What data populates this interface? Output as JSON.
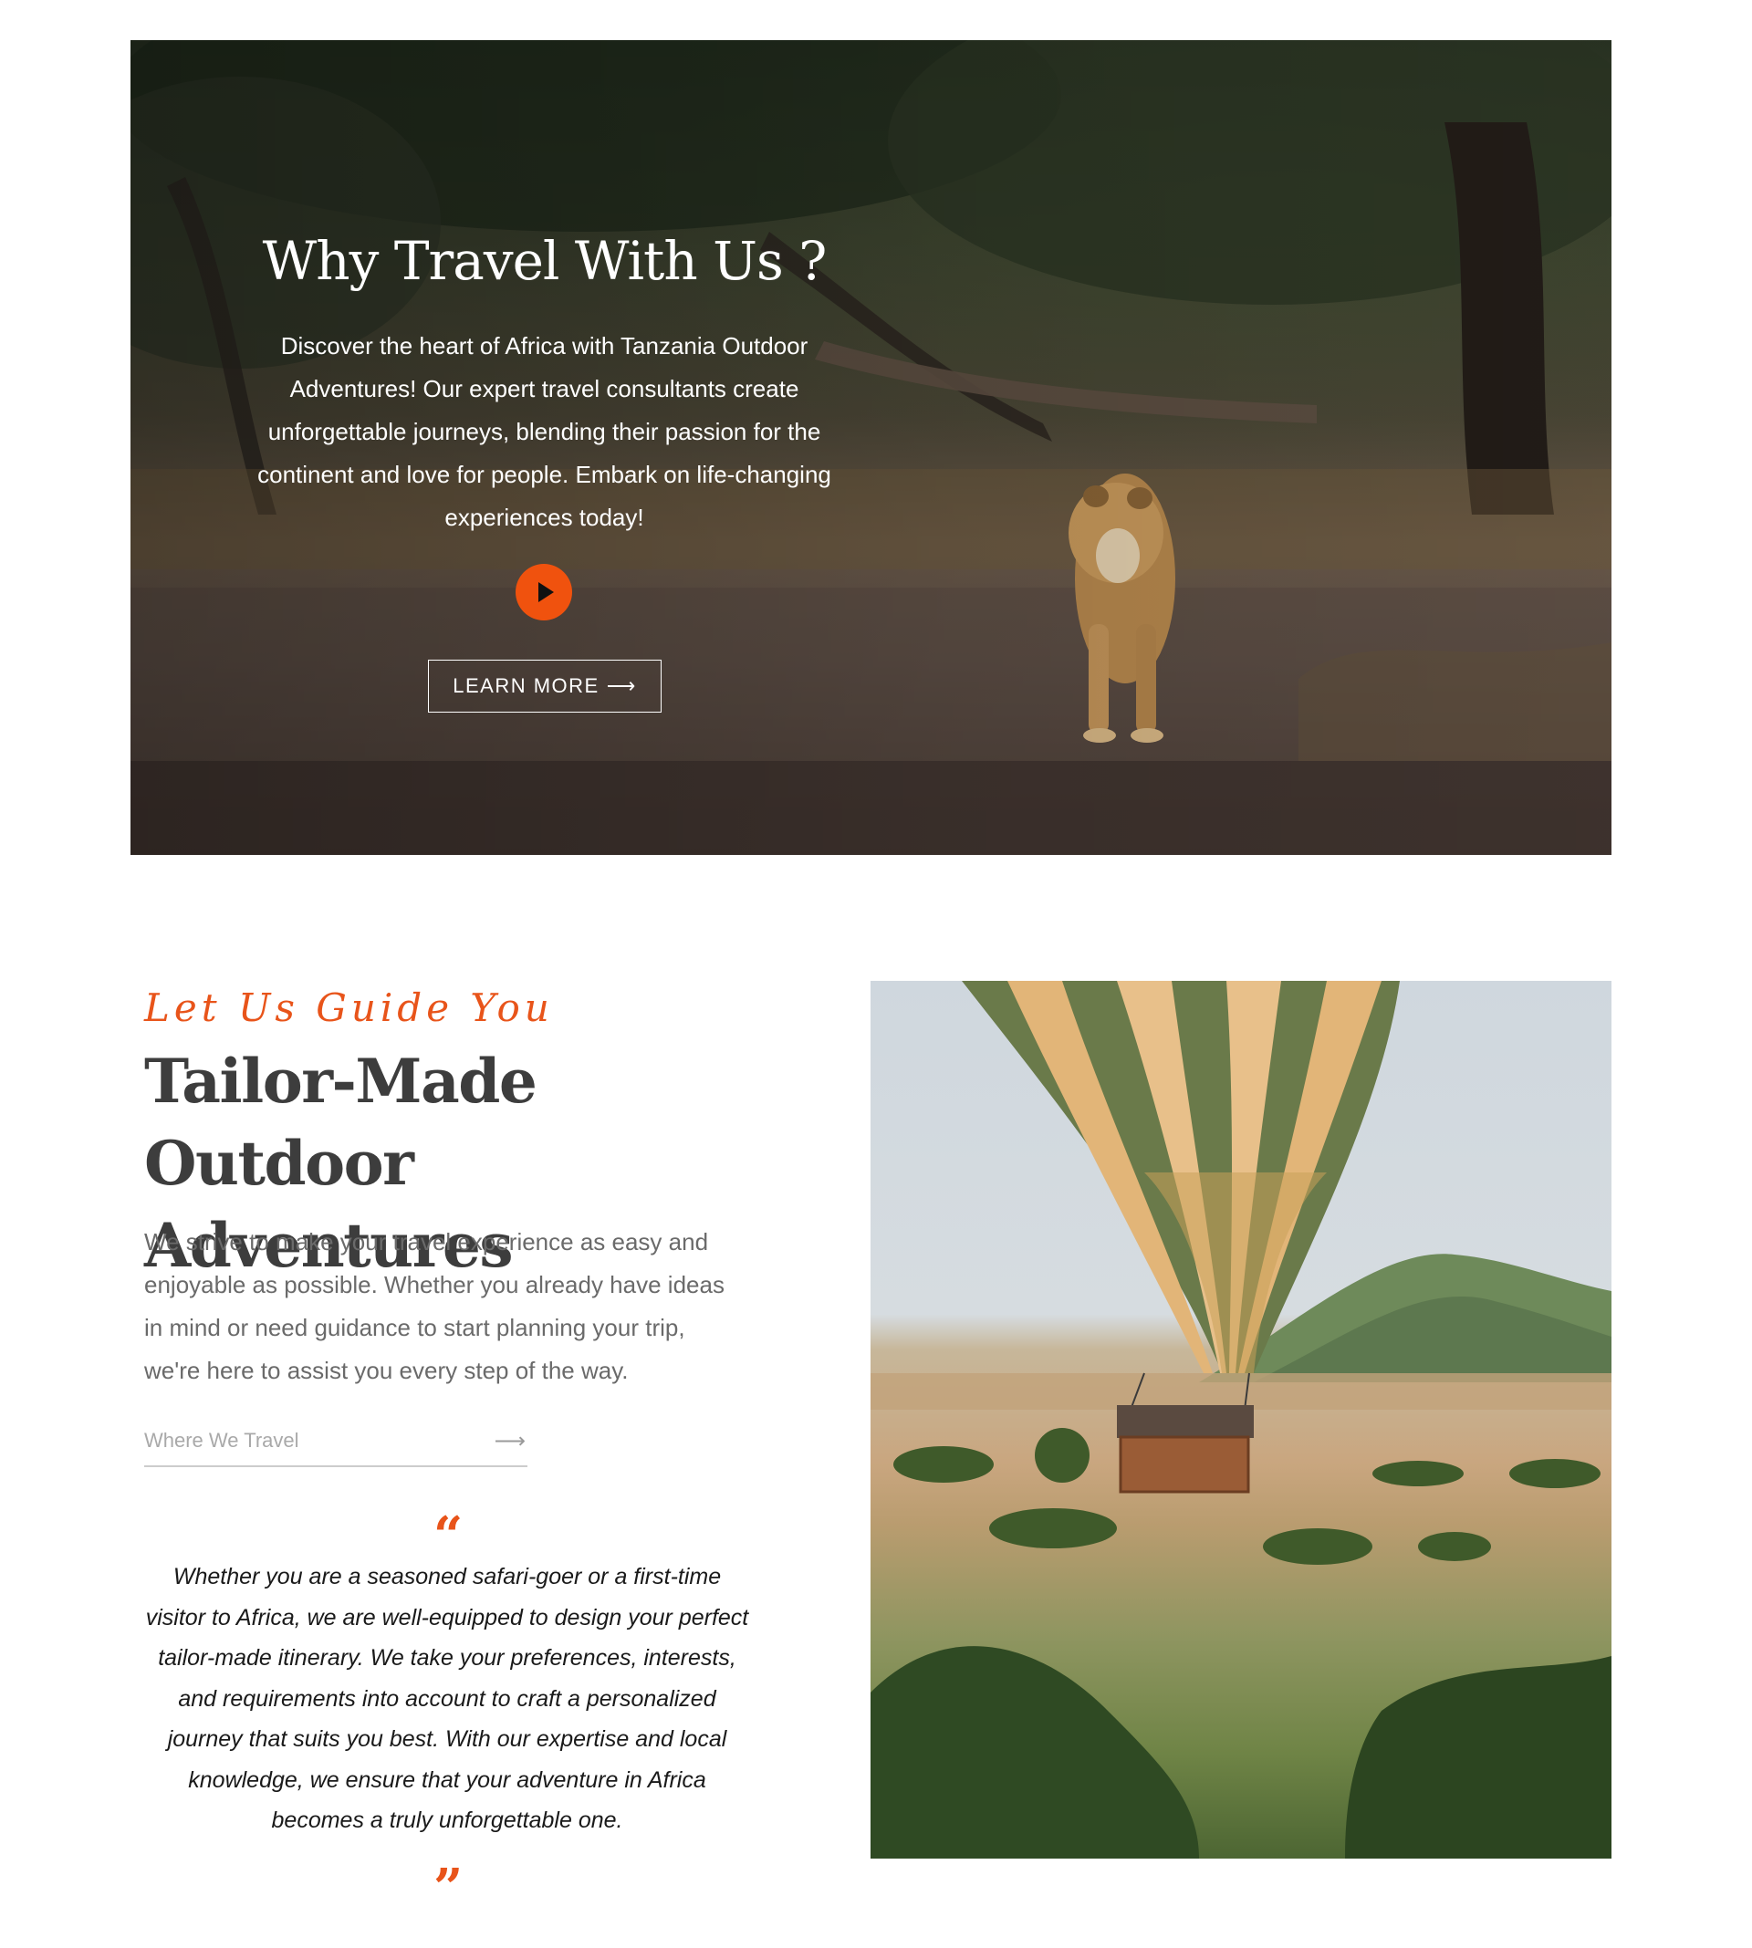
{
  "hero": {
    "title": "Why Travel With Us ?",
    "description": "Discover the heart of Africa with Tanzania Outdoor Adventures! Our expert travel consultants create unforgettable journeys, blending their passion for the continent and love for people. Embark on life-changing experiences today!",
    "play_icon": "play-icon",
    "button_label": "LEARN MORE",
    "button_arrow": "⟶",
    "accent_color": "#f0520e"
  },
  "tailor": {
    "subtitle": "Let Us Guide You",
    "heading": "Tailor-Made Outdoor Adventures",
    "body": "We strive to make your travel experience as easy and enjoyable as possible. Whether you already have ideas in mind or need guidance to start planning your trip, we're here to assist you every step of the way.",
    "link_label": "Where We Travel",
    "link_arrow": "⟶",
    "quote_open": "“",
    "quote_close": "”",
    "quote": "Whether you are a seasoned safari-goer or a first-time visitor to Africa, we are well-equipped to design your perfect tailor-made itinerary. We take your preferences, interests, and requirements into account to craft a personalized journey that suits you best. With our expertise and local knowledge, we ensure that your adventure in Africa becomes a truly unforgettable one.",
    "accent_color": "#e8541a"
  }
}
